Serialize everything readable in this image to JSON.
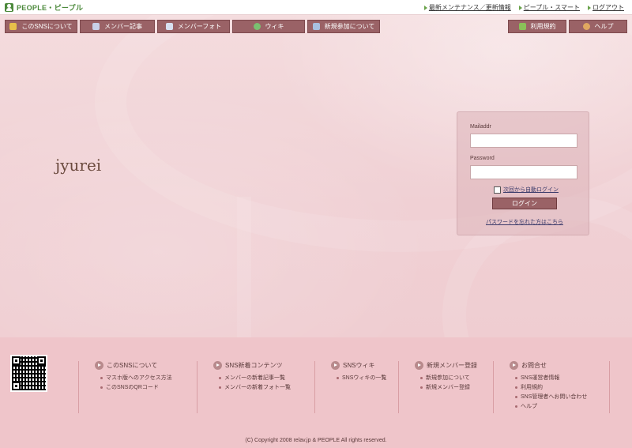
{
  "brand": {
    "name": "PEOPLE・ピープル"
  },
  "top_links": [
    {
      "label": "最新メンテナンス／更新情報"
    },
    {
      "label": "ピープル・スマート"
    },
    {
      "label": "ログアウト"
    }
  ],
  "nav": {
    "left": [
      {
        "label": "このSNSについて",
        "icon": "about-icon",
        "color": "#e8c04a"
      },
      {
        "label": "メンバー記事",
        "icon": "article-icon",
        "color": "#c8d0e8"
      },
      {
        "label": "メンバーフォト",
        "icon": "photo-icon",
        "color": "#d8e0f0"
      },
      {
        "label": "ウィキ",
        "icon": "wiki-icon",
        "color": "#7ac070"
      },
      {
        "label": "新規参加について",
        "icon": "join-icon",
        "color": "#a8c0e0"
      }
    ],
    "right": [
      {
        "label": "利用規約",
        "icon": "terms-icon",
        "color": "#8ac058"
      },
      {
        "label": "ヘルプ",
        "icon": "help-icon",
        "color": "#e0a860"
      }
    ]
  },
  "site_name": "jyurei",
  "login": {
    "mail_label": "Mailaddr",
    "mail_value": "",
    "password_label": "Password",
    "password_value": "",
    "auto_login_label": "次回から自動ログイン",
    "auto_login_checked": false,
    "submit_label": "ログイン",
    "forgot_label": "パスワードを忘れた方はこちら"
  },
  "footer": {
    "columns": [
      {
        "heading": "このSNSについて",
        "items": [
          "マスホ版へのアクセス方法",
          "このSNSのQRコード"
        ]
      },
      {
        "heading": "SNS新着コンテンツ",
        "items": [
          "メンバーの新着記事一覧",
          "メンバーの新着フォト一覧"
        ]
      },
      {
        "heading": "SNSウィキ",
        "items": [
          "SNSウィキの一覧"
        ]
      },
      {
        "heading": "新規メンバー登録",
        "items": [
          "新規参加について",
          "新規メンバー登録"
        ]
      },
      {
        "heading": "お問合せ",
        "items": [
          "SNS運営者情報",
          "利用規約",
          "SNS管理者へお問い合わせ",
          "ヘルプ"
        ]
      }
    ],
    "copyright": "(C) Copyright 2008 relav.jp & PEOPLE All rights reserved."
  },
  "colors": {
    "nav_button": "#9a6266",
    "background": "#f1cdd0",
    "brand_green": "#4c8a3c"
  }
}
